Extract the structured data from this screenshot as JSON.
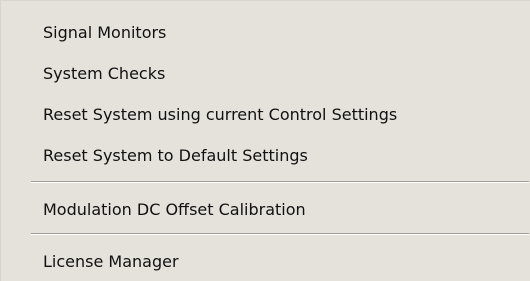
{
  "context_menu": {
    "items": [
      {
        "label": "Signal Monitors"
      },
      {
        "label": "System Checks"
      },
      {
        "label": "Reset System using current Control Settings"
      },
      {
        "label": "Reset System to Default Settings"
      },
      {
        "label": "Modulation DC Offset Calibration"
      },
      {
        "label": "License Manager"
      }
    ]
  }
}
